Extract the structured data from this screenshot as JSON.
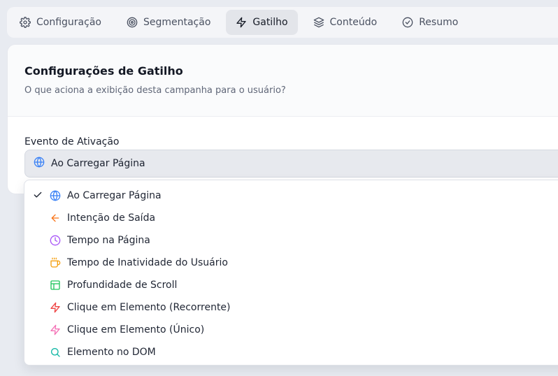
{
  "tabs": [
    {
      "label": "Configuração",
      "icon": "gear-icon"
    },
    {
      "label": "Segmentação",
      "icon": "target-icon"
    },
    {
      "label": "Gatilho",
      "icon": "zap-icon",
      "active": true
    },
    {
      "label": "Conteúdo",
      "icon": "layers-icon"
    },
    {
      "label": "Resumo",
      "icon": "check-circle-icon"
    }
  ],
  "card": {
    "title": "Configurações de Gatilho",
    "subtitle": "O que aciona a exibição desta campanha para o usuário?"
  },
  "trigger": {
    "label": "Evento de Ativação",
    "selected": "Ao Carregar Página",
    "selected_icon": "globe-icon"
  },
  "options": [
    {
      "label": "Ao Carregar Página",
      "icon": "globe-icon",
      "color": "#3b82f6",
      "selected": true
    },
    {
      "label": "Intenção de Saída",
      "icon": "arrow-left-icon",
      "color": "#f97316"
    },
    {
      "label": "Tempo na Página",
      "icon": "clock-icon",
      "color": "#a855f7"
    },
    {
      "label": "Tempo de Inatividade do Usuário",
      "icon": "coffee-icon",
      "color": "#f59e0b"
    },
    {
      "label": "Profundidade de Scroll",
      "icon": "layout-icon",
      "color": "#22c55e"
    },
    {
      "label": "Clique em Elemento (Recorrente)",
      "icon": "zap-icon",
      "color": "#ef4444"
    },
    {
      "label": "Clique em Elemento (Único)",
      "icon": "zap-icon",
      "color": "#f472b6"
    },
    {
      "label": "Elemento no DOM",
      "icon": "search-icon",
      "color": "#14b8a6"
    }
  ]
}
